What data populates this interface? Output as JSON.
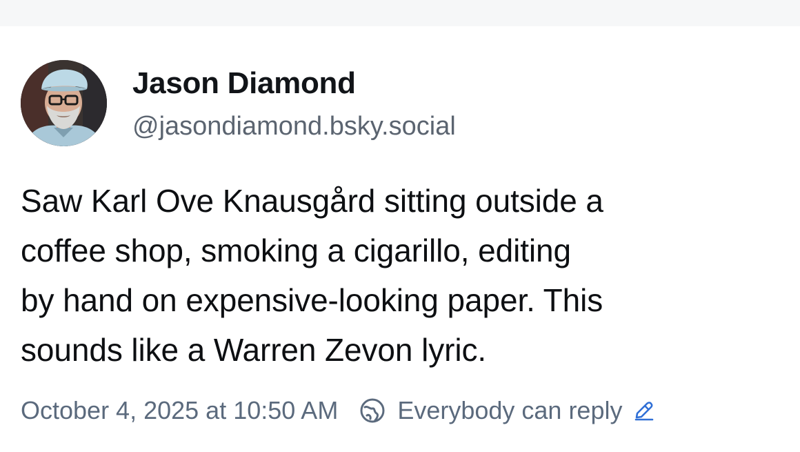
{
  "post": {
    "author": {
      "display_name": "Jason Diamond",
      "handle": "@jasondiamond.bsky.social"
    },
    "text_lines": [
      "Saw Karl Ove Knausgård sitting outside a",
      "coffee shop, smoking a cigarillo, editing",
      "by hand on expensive-looking paper. This",
      "sounds like a Warren Zevon lyric."
    ],
    "timestamp": "October 4, 2025 at 10:50 AM",
    "reply_setting": "Everybody can reply",
    "icons": {
      "reply_setting_icon": "globe-icon",
      "edit_icon": "pencil-icon"
    },
    "colors": {
      "text": "#0d0f12",
      "muted": "#5b6a7d",
      "accent": "#2f6fd6"
    }
  }
}
